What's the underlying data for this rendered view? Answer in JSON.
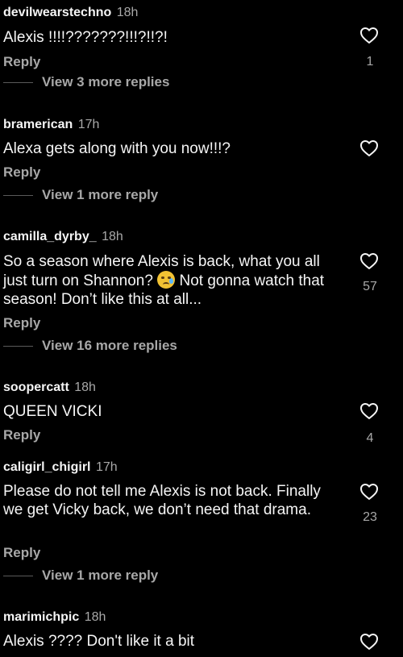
{
  "comments": [
    {
      "username": "devilwearstechno",
      "time": "18h",
      "text": "Alexis !!!!???????!!!?!!?!",
      "reply_label": "Reply",
      "likes": "1",
      "view_more": "View 3 more replies"
    },
    {
      "username": "bramerican",
      "time": "17h",
      "text": "Alexa gets along with you now!!!?",
      "reply_label": "Reply",
      "likes": "",
      "view_more": "View 1 more reply"
    },
    {
      "username": "camilla_dyrby_",
      "time": "18h",
      "text_before": "So a season where Alexis is back, what you all just turn on Shannon? ",
      "emoji": "crying-face-emoji",
      "text_after": " Not gonna watch that season! Don’t like this at all...",
      "reply_label": "Reply",
      "likes": "57",
      "view_more": "View 16 more replies"
    },
    {
      "username": "soopercatt",
      "time": "18h",
      "text": "QUEEN VICKI",
      "reply_label": "Reply",
      "likes": "4"
    },
    {
      "username": "caligirl_chigirl",
      "time": "17h",
      "text": "Please do not tell me Alexis is not back. Finally we get Vicky back, we don’t need that drama.",
      "reply_label": "Reply",
      "likes": "23",
      "view_more": "View 1 more reply"
    },
    {
      "username": "marimichpic",
      "time": "18h",
      "text": "Alexis ???? Don't like it a bit"
    }
  ],
  "icons": {
    "like": "heart-outline-icon"
  },
  "colors": {
    "background": "#000000",
    "primary_text": "#f5f5f5",
    "secondary_text": "#a8a8a8"
  }
}
